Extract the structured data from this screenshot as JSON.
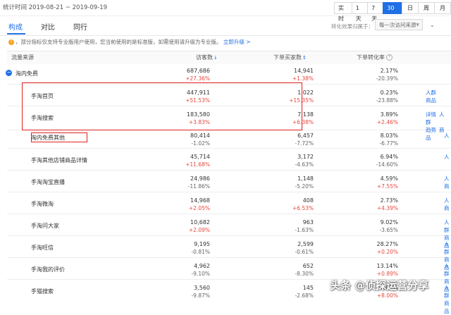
{
  "header": {
    "date_range": "统计时间 2019-08-21 ~ 2019-09-19",
    "range_buttons": [
      "实时",
      "1天",
      "7天",
      "30天",
      "日",
      "周",
      "月"
    ],
    "active_range": "30天"
  },
  "tabs": [
    "构成",
    "对比",
    "同行"
  ],
  "active_tab": "构成",
  "filter": {
    "label": "转化效果归属于：",
    "select_value": "每一次访问来源",
    "extra": "⌄"
  },
  "notice": {
    "text": "，部分指标仅支持专业版用户使用，您当前使用的是标准版，如需使用请升级为专业版。",
    "link": "立即升级 >"
  },
  "columns": {
    "source": "流量来源",
    "visitors": "访客数",
    "buyers": "下单买家数",
    "rate": "下单转化率"
  },
  "group": {
    "label": "淘内免费",
    "visitors": "687,686",
    "visitors_change": "+27.36%",
    "buyers": "14,941",
    "buyers_change": "+1.38%",
    "rate": "2.17%",
    "rate_change": "-20.39%"
  },
  "rows": [
    {
      "source": "手淘首页",
      "visitors": "447,911",
      "visitors_change": "+51.53%",
      "buyers": "1,022",
      "buyers_change": "+15.35%",
      "rate": "0.23%",
      "rate_change": "-23.88%",
      "actions": [
        "人群",
        "商品"
      ]
    },
    {
      "source": "手淘搜索",
      "visitors": "183,580",
      "visitors_change": "+3.83%",
      "buyers": "7,138",
      "buyers_change": "+6.38%",
      "rate": "3.89%",
      "rate_change": "+2.46%",
      "actions": [
        "详情",
        "人群",
        "趋势",
        "商品"
      ]
    },
    {
      "source": "淘内免费其他",
      "visitors": "80,414",
      "visitors_change": "-1.02%",
      "buyers": "6,457",
      "buyers_change": "-7.72%",
      "rate": "8.03%",
      "rate_change": "-6.77%",
      "actions": [
        "",
        "人"
      ]
    },
    {
      "source": "手淘其他店铺商品详情",
      "visitors": "45,714",
      "visitors_change": "+11.68%",
      "buyers": "3,172",
      "buyers_change": "-4.63%",
      "rate": "6.94%",
      "rate_change": "-14.60%",
      "actions": [
        "",
        "人"
      ]
    },
    {
      "source": "手淘淘宝直播",
      "visitors": "24,986",
      "visitors_change": "-11.86%",
      "buyers": "1,148",
      "buyers_change": "-5.20%",
      "rate": "4.59%",
      "rate_change": "+7.55%",
      "actions": [
        "人",
        "商"
      ]
    },
    {
      "source": "手淘微淘",
      "visitors": "14,968",
      "visitors_change": "+2.05%",
      "buyers": "408",
      "buyers_change": "+6.53%",
      "rate": "2.73%",
      "rate_change": "+4.39%",
      "actions": [
        "人",
        "商"
      ]
    },
    {
      "source": "手淘问大家",
      "visitors": "10,682",
      "visitors_change": "+2.09%",
      "buyers": "963",
      "buyers_change": "-1.63%",
      "rate": "9.02%",
      "rate_change": "-3.65%",
      "actions": [
        "人群",
        "商品"
      ]
    },
    {
      "source": "手淘旺信",
      "visitors": "9,195",
      "visitors_change": "-0.81%",
      "buyers": "2,599",
      "buyers_change": "-0.61%",
      "rate": "28.27%",
      "rate_change": "+0.20%",
      "actions": [
        "人群",
        "商品"
      ]
    },
    {
      "source": "手淘我的评价",
      "visitors": "4,962",
      "visitors_change": "-9.10%",
      "buyers": "652",
      "buyers_change": "-8.30%",
      "rate": "13.14%",
      "rate_change": "+0.89%",
      "actions": [
        "人群",
        "商品"
      ]
    },
    {
      "source": "手猫搜索",
      "visitors": "3,560",
      "visitors_change": "-9.87%",
      "buyers": "145",
      "buyers_change": "-2.68%",
      "rate": "4.07%",
      "rate_change": "+8.00%",
      "actions": [
        "人群",
        "商品"
      ]
    }
  ],
  "watermark": "头条 @侦探运营分享",
  "colors": {
    "accent": "#1f6fe5",
    "increase": "#e8473d",
    "highlight_border": "#e02020"
  }
}
